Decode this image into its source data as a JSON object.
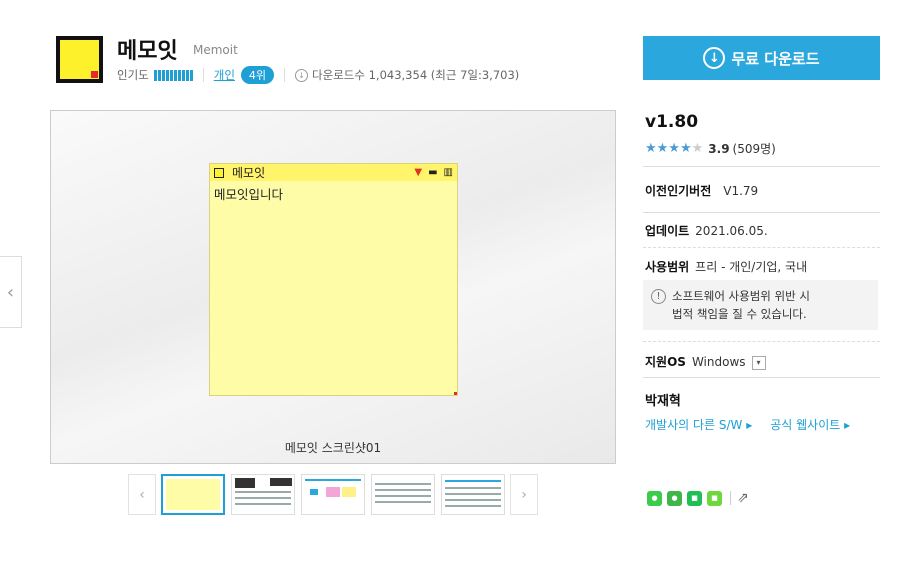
{
  "app": {
    "title": "메모잇",
    "title_en": "Memoit",
    "popularity_label": "인기도",
    "category": "개인",
    "rank": "4위",
    "downloads": "다운로드수 1,043,354 (최근 7일:3,703)"
  },
  "download_button": {
    "label": "무료 다운로드"
  },
  "preview": {
    "memo_title": "메모잇",
    "memo_body": "메모잇입니다",
    "caption": "메모잇 스크린샷01"
  },
  "details": {
    "version": "v1.80",
    "rating_score": "3.9",
    "rating_count": "(509명)",
    "rating_value": 3.9,
    "prev_version_label": "이전인기버전",
    "prev_version_value": "V1.79",
    "update_label": "업데이트",
    "update_value": "2021.06.05.",
    "license_label": "사용범위",
    "license_value": "프리 - 개인/기업, 국내",
    "warning_line1": "소프트웨어 사용범위 위반 시",
    "warning_line2": "법적 책임을 질 수 있습니다.",
    "os_label": "지원OS",
    "os_value": "Windows",
    "developer": "박재혁",
    "dev_link1": "개발사의 다른 S/W ▸",
    "dev_link2": "공식 웹사이트 ▸"
  },
  "colors": {
    "accent": "#2aa7dd",
    "memo_yellow": "#fffca8",
    "star": "#4d9bd5"
  },
  "icons": [
    "app-logo-icon",
    "download-icon",
    "chevron-left-icon",
    "chevron-right-icon",
    "warning-icon",
    "dropdown-icon",
    "line-share-icon",
    "kakao-share-icon",
    "band-share-icon",
    "naver-share-icon",
    "share-out-icon"
  ]
}
